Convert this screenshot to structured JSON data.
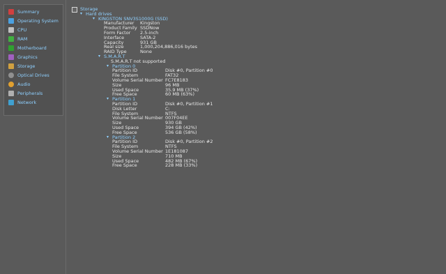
{
  "sidebar": {
    "items": [
      {
        "label": "Summary",
        "icon": "summary-icon",
        "color": "#d04040"
      },
      {
        "label": "Operating System",
        "icon": "os-icon",
        "color": "#4aa0e0"
      },
      {
        "label": "CPU",
        "icon": "cpu-icon",
        "color": "#c0c0c0"
      },
      {
        "label": "RAM",
        "icon": "ram-icon",
        "color": "#40b040"
      },
      {
        "label": "Motherboard",
        "icon": "motherboard-icon",
        "color": "#30a030"
      },
      {
        "label": "Graphics",
        "icon": "graphics-icon",
        "color": "#a060c0"
      },
      {
        "label": "Storage",
        "icon": "storage-icon",
        "color": "#d0a040"
      },
      {
        "label": "Optical Drives",
        "icon": "optical-drive-icon",
        "color": "#909090"
      },
      {
        "label": "Audio",
        "icon": "audio-icon",
        "color": "#e0a030"
      },
      {
        "label": "Peripherals",
        "icon": "peripherals-icon",
        "color": "#b0b0b0"
      },
      {
        "label": "Network",
        "icon": "network-icon",
        "color": "#40a0d0"
      }
    ]
  },
  "main": {
    "storage_title": "Storage",
    "hard_drives": "Hard drives",
    "drive_name": "KINGSTON SNV3S1000G (SSD)",
    "drive_props": [
      {
        "k": "Manufacturer",
        "v": "Kingston"
      },
      {
        "k": "Product Family",
        "v": "SSDNow"
      },
      {
        "k": "Form Factor",
        "v": "2.5-inch"
      },
      {
        "k": "Interface",
        "v": "SATA-2"
      },
      {
        "k": "Capacity",
        "v": "931 GB"
      },
      {
        "k": "Real size",
        "v": "1,000,204,886,016 bytes"
      },
      {
        "k": "RAID Type",
        "v": "None"
      }
    ],
    "smart_title": "S.M.A.R.T",
    "smart_text": "S.M.A.R.T not supported",
    "partitions": [
      {
        "title": "Partition 0",
        "props": [
          {
            "k": "Partition ID",
            "v": "Disk #0, Partition #0"
          },
          {
            "k": "File System",
            "v": "FAT32"
          },
          {
            "k": "Volume Serial Number",
            "v": "FC7E8183"
          },
          {
            "k": "Size",
            "v": "96 MB"
          },
          {
            "k": "Used Space",
            "v": "35.9 MB (37%)"
          },
          {
            "k": "Free Space",
            "v": "60 MB (63%)"
          }
        ]
      },
      {
        "title": "Partition 1",
        "props": [
          {
            "k": "Partition ID",
            "v": "Disk #0, Partition #1"
          },
          {
            "k": "Disk Letter",
            "v": "C:"
          },
          {
            "k": "File System",
            "v": "NTFS"
          },
          {
            "k": "Volume Serial Number",
            "v": "007F04EE"
          },
          {
            "k": "Size",
            "v": "930 GB"
          },
          {
            "k": "Used Space",
            "v": "394 GB (42%)"
          },
          {
            "k": "Free Space",
            "v": "536 GB (58%)"
          }
        ]
      },
      {
        "title": "Partition 2",
        "props": [
          {
            "k": "Partition ID",
            "v": "Disk #0, Partition #2"
          },
          {
            "k": "File System",
            "v": "NTFS"
          },
          {
            "k": "Volume Serial Number",
            "v": "1E181087"
          },
          {
            "k": "Size",
            "v": "710 MB"
          },
          {
            "k": "Used Space",
            "v": "482 MB (67%)"
          },
          {
            "k": "Free Space",
            "v": "228 MB (33%)"
          }
        ]
      }
    ]
  }
}
